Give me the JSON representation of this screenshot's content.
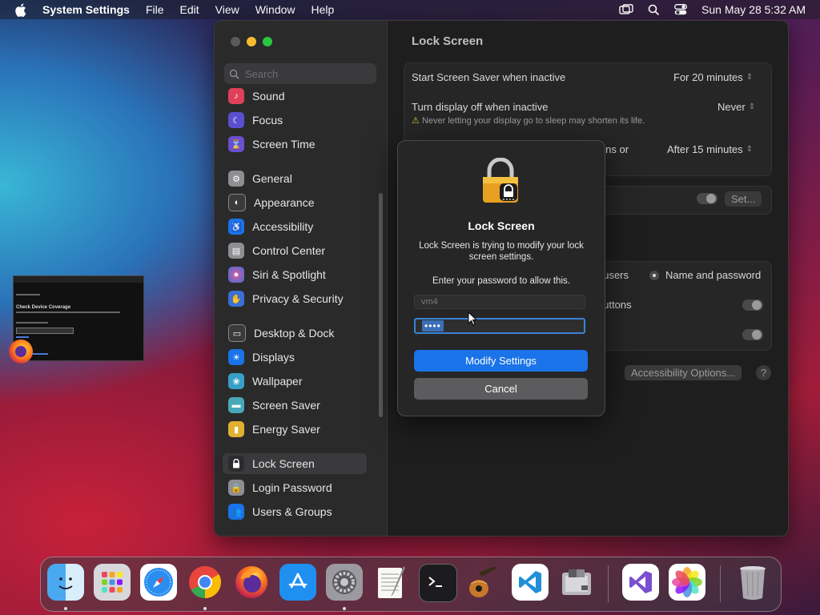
{
  "menubar": {
    "app_name": "System Settings",
    "menus": [
      "File",
      "Edit",
      "View",
      "Window",
      "Help"
    ],
    "clock": "Sun May 28  5:32 AM"
  },
  "sidebar": {
    "search_placeholder": "Search",
    "items": [
      {
        "label": "Sound",
        "icon": "sound-icon",
        "color": "#e0405a"
      },
      {
        "label": "Focus",
        "icon": "focus-icon",
        "color": "#5a4fcf"
      },
      {
        "label": "Screen Time",
        "icon": "screen-time-icon",
        "color": "#6a4fcf"
      },
      {
        "label": "General",
        "icon": "gear-icon",
        "color": "#8e8e93"
      },
      {
        "label": "Appearance",
        "icon": "appearance-icon",
        "color": "#3a3a3c"
      },
      {
        "label": "Accessibility",
        "icon": "accessibility-icon",
        "color": "#1a73e8"
      },
      {
        "label": "Control Center",
        "icon": "control-center-icon",
        "color": "#8e8e93"
      },
      {
        "label": "Siri & Spotlight",
        "icon": "siri-icon",
        "color": "#c0397a"
      },
      {
        "label": "Privacy & Security",
        "icon": "hand-icon",
        "color": "#3a6fd8"
      },
      {
        "label": "Desktop & Dock",
        "icon": "desktop-icon",
        "color": "#3a3a3c"
      },
      {
        "label": "Displays",
        "icon": "displays-icon",
        "color": "#1a73e8"
      },
      {
        "label": "Wallpaper",
        "icon": "wallpaper-icon",
        "color": "#38a0c8"
      },
      {
        "label": "Screen Saver",
        "icon": "screen-saver-icon",
        "color": "#48a8b8"
      },
      {
        "label": "Energy Saver",
        "icon": "battery-icon",
        "color": "#e0b030"
      },
      {
        "label": "Lock Screen",
        "icon": "lock-icon",
        "color": "#2c2c2e"
      },
      {
        "label": "Login Password",
        "icon": "login-password-icon",
        "color": "#8e8e93"
      },
      {
        "label": "Users & Groups",
        "icon": "users-icon",
        "color": "#1a73e8"
      }
    ]
  },
  "content": {
    "title": "Lock Screen",
    "screen_saver_label": "Start Screen Saver when inactive",
    "screen_saver_value": "For 20 minutes",
    "display_off_label": "Turn display off when inactive",
    "display_off_value": "Never",
    "warning": "Never letting your display go to sleep may shorten its life.",
    "require_password_partial": "gins or",
    "require_password_value": "After 15 minutes",
    "set_button": "Set...",
    "users_partial": "f users",
    "name_and_password": "Name and password",
    "buttons_partial": "buttons",
    "accessibility_options": "Accessibility Options...",
    "help": "?"
  },
  "dialog": {
    "title": "Lock Screen",
    "message": "Lock Screen is trying to modify your lock screen settings.",
    "prompt": "Enter your password to allow this.",
    "username": "vm4",
    "password_mask": "••••",
    "primary_button": "Modify Settings",
    "cancel_button": "Cancel"
  },
  "thumbnail": {
    "heading": "Check Device Coverage"
  },
  "dock": {
    "items": [
      "finder-icon",
      "launchpad-icon",
      "safari-icon",
      "chrome-icon",
      "firefox-icon",
      "app-store-icon",
      "system-settings-icon",
      "textedit-icon",
      "terminal-icon",
      "garageband-icon",
      "vscode-icon",
      "boot-camp-icon",
      "visual-studio-icon",
      "photos-icon",
      "trash-icon"
    ]
  }
}
